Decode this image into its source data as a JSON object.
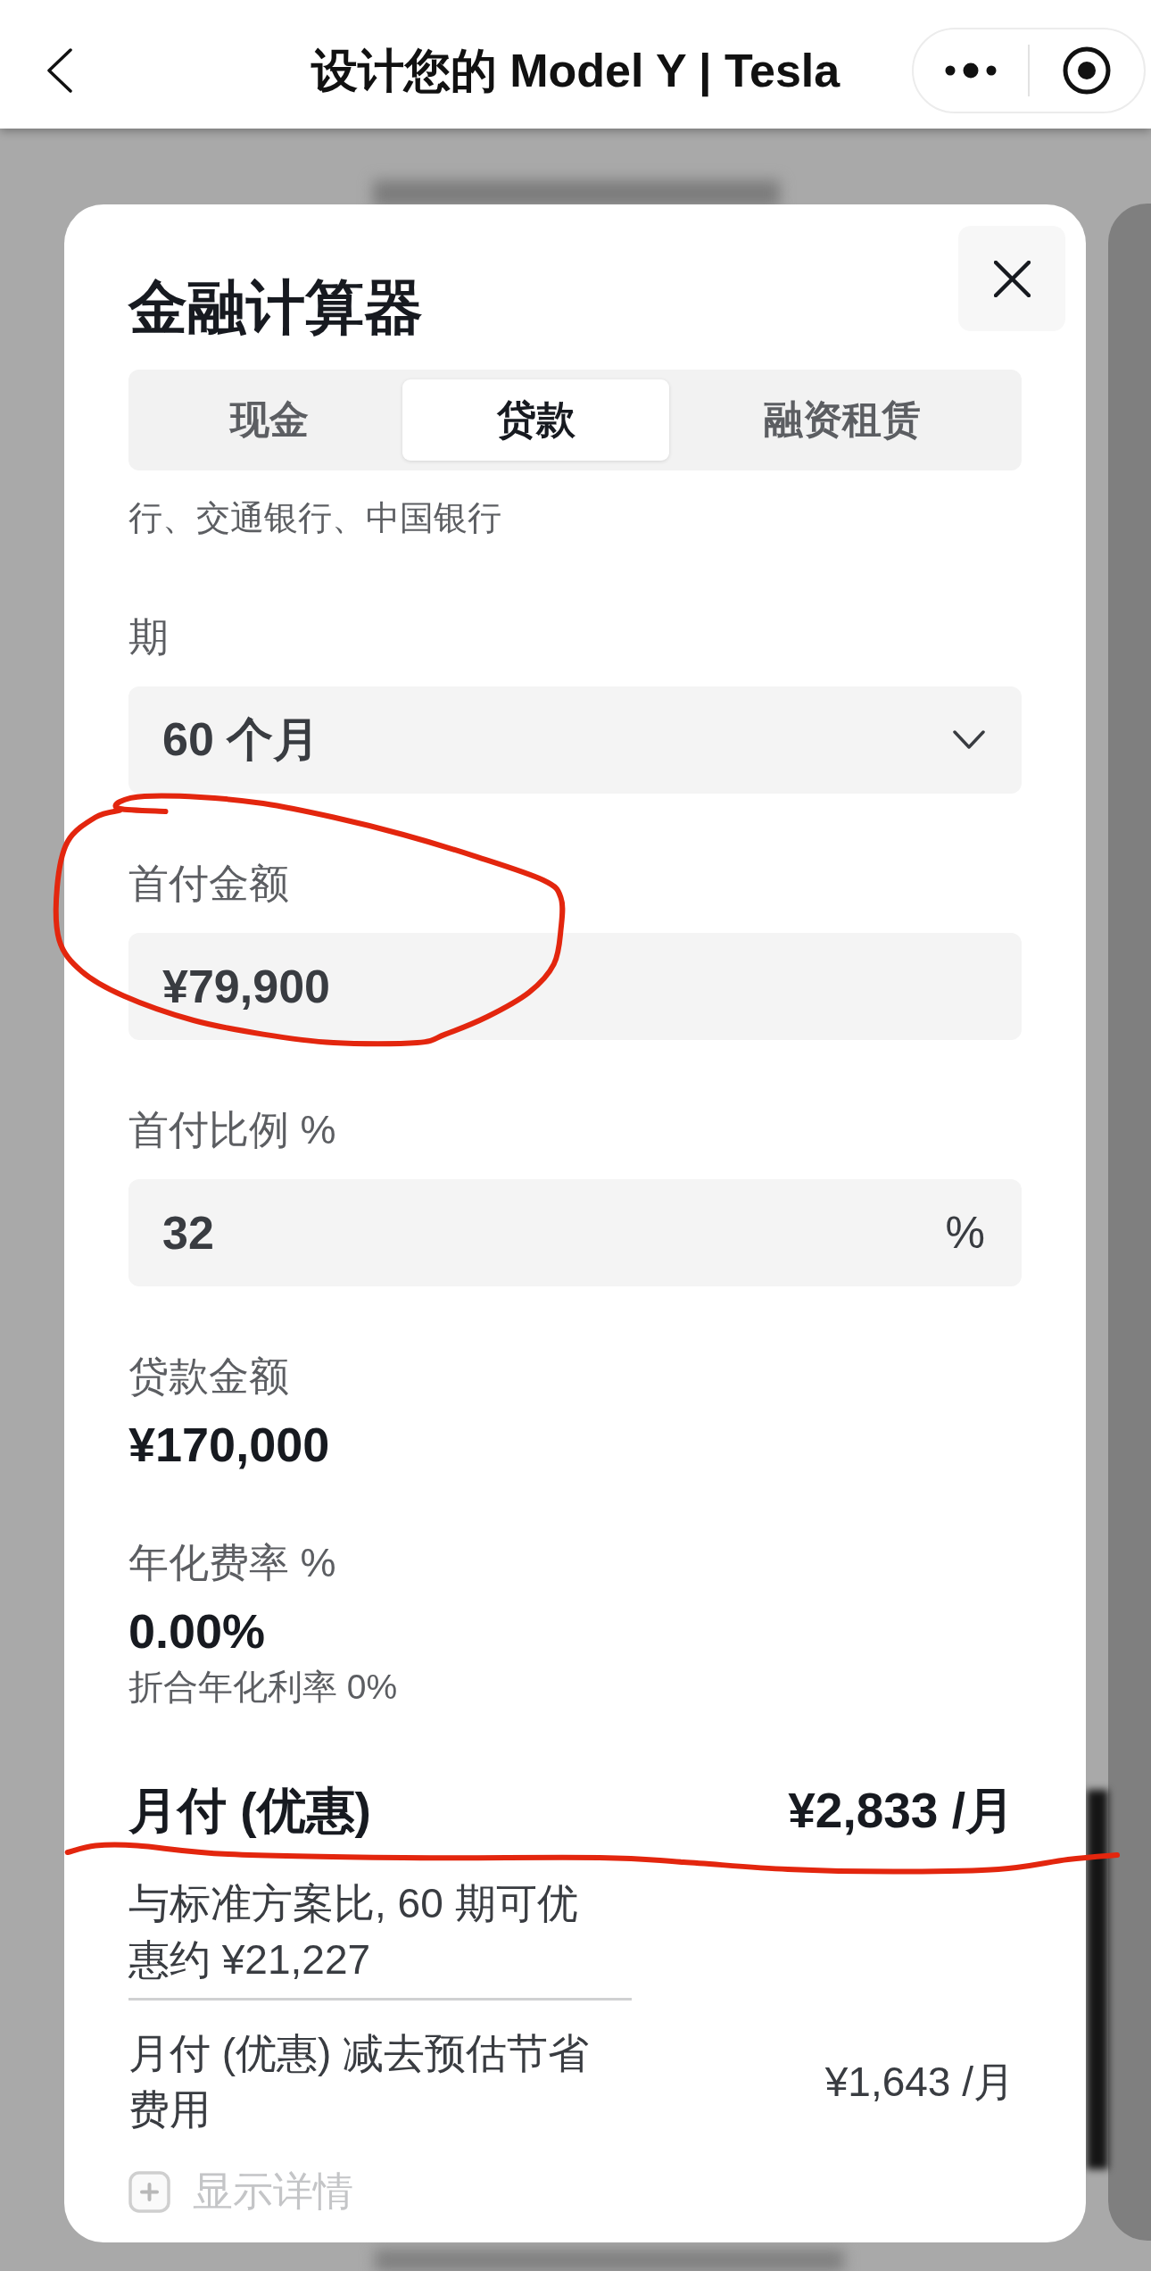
{
  "top_bar": {
    "title": "设计您的 Model Y | Tesla"
  },
  "calculator": {
    "title": "金融计算器",
    "tabs": [
      {
        "label": "现金",
        "selected": false
      },
      {
        "label": "贷款",
        "selected": true
      },
      {
        "label": "融资租赁",
        "selected": false
      }
    ],
    "lender_list": "行、交通银行、中国银行",
    "fields": [
      {
        "kind": "select",
        "label": "期",
        "value": "60 个月",
        "circled": false
      },
      {
        "kind": "input",
        "label": "首付金额",
        "value": "¥79,900",
        "circled": true
      },
      {
        "kind": "input",
        "label": "首付比例 %",
        "value": "32",
        "unit": "%",
        "circled": false
      },
      {
        "kind": "readout",
        "label": "贷款金额",
        "value": "¥170,000",
        "circled": false
      },
      {
        "kind": "readout",
        "label": "年化费率 %",
        "value": "0.00%",
        "note": "折合年化利率 0%",
        "circled": false
      }
    ],
    "monthly_payment": {
      "label": "月付 (优惠)",
      "value": "¥2,833 /月",
      "underlined": true
    },
    "savings_note": "与标准方案比, 60 期可优惠约 ¥21,227",
    "net_payment": {
      "label": "月付 (优惠) 减去预估节省费用",
      "value": "¥1,643 /月"
    },
    "details_toggle": {
      "label": "显示详情",
      "expanded": false
    }
  }
}
